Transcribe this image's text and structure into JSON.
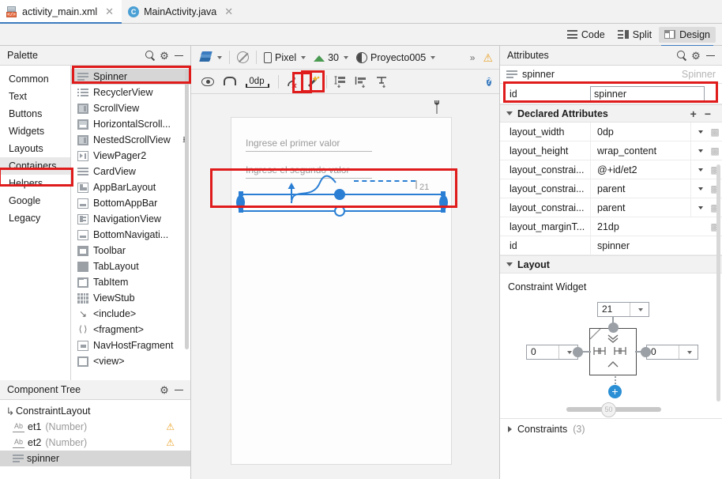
{
  "tabs": [
    {
      "label": "activity_main.xml",
      "icon": "xml-file-icon",
      "active": true
    },
    {
      "label": "MainActivity.java",
      "icon": "java-class-icon",
      "active": false
    }
  ],
  "modebar": {
    "code_label": "Code",
    "split_label": "Split",
    "design_label": "Design",
    "active": "Design"
  },
  "palette": {
    "title": "Palette",
    "categories": [
      {
        "label": "Common",
        "selected": false
      },
      {
        "label": "Text",
        "selected": false
      },
      {
        "label": "Buttons",
        "selected": false
      },
      {
        "label": "Widgets",
        "selected": false
      },
      {
        "label": "Layouts",
        "selected": false
      },
      {
        "label": "Containers",
        "selected": true
      },
      {
        "label": "Helpers",
        "selected": false
      },
      {
        "label": "Google",
        "selected": false
      },
      {
        "label": "Legacy",
        "selected": false
      }
    ],
    "items": [
      {
        "label": "Spinner",
        "selected": true,
        "download": false
      },
      {
        "label": "RecyclerView",
        "selected": false,
        "download": false
      },
      {
        "label": "ScrollView",
        "selected": false,
        "download": false
      },
      {
        "label": "HorizontalScroll...",
        "selected": false,
        "download": false
      },
      {
        "label": "NestedScrollView",
        "selected": false,
        "download": true
      },
      {
        "label": "ViewPager2",
        "selected": false,
        "download": false
      },
      {
        "label": "CardView",
        "selected": false,
        "download": false
      },
      {
        "label": "AppBarLayout",
        "selected": false,
        "download": false
      },
      {
        "label": "BottomAppBar",
        "selected": false,
        "download": false
      },
      {
        "label": "NavigationView",
        "selected": false,
        "download": false
      },
      {
        "label": "BottomNavigati...",
        "selected": false,
        "download": false
      },
      {
        "label": "Toolbar",
        "selected": false,
        "download": false
      },
      {
        "label": "TabLayout",
        "selected": false,
        "download": false
      },
      {
        "label": "TabItem",
        "selected": false,
        "download": false
      },
      {
        "label": "ViewStub",
        "selected": false,
        "download": false
      },
      {
        "label": "<include>",
        "selected": false,
        "download": false
      },
      {
        "label": "<fragment>",
        "selected": false,
        "download": false
      },
      {
        "label": "NavHostFragment",
        "selected": false,
        "download": false
      },
      {
        "label": "<view>",
        "selected": false,
        "download": false
      }
    ]
  },
  "component_tree": {
    "title": "Component Tree",
    "rows": [
      {
        "label": "ConstraintLayout",
        "sub": "",
        "warning": false,
        "selected": false,
        "depth": 0,
        "icon": "constraintlayout-icon"
      },
      {
        "label": "et1",
        "sub": "(Number)",
        "warning": true,
        "selected": false,
        "depth": 1,
        "icon": "textfield-icon"
      },
      {
        "label": "et2",
        "sub": "(Number)",
        "warning": true,
        "selected": false,
        "depth": 1,
        "icon": "textfield-icon"
      },
      {
        "label": "spinner",
        "sub": "",
        "warning": false,
        "selected": true,
        "depth": 1,
        "icon": "spinner-icon"
      }
    ]
  },
  "design_toolbar": {
    "device_label": "Pixel",
    "api_label": "30",
    "theme_label": "Proyecto005",
    "overflow_label": "»",
    "default_margin_label": "0dp"
  },
  "canvas": {
    "hint_first": "Ingrese el primer valor",
    "hint_second": "Ingrese el segundo valor",
    "margin_label": "21"
  },
  "attributes": {
    "title": "Attributes",
    "object_name": "spinner",
    "object_class": "Spinner",
    "id_key": "id",
    "id_value": "spinner",
    "declared_header": "Declared Attributes",
    "rows": [
      {
        "key": "layout_width",
        "value": "0dp",
        "dropdown": true
      },
      {
        "key": "layout_height",
        "value": "wrap_content",
        "dropdown": true
      },
      {
        "key": "layout_constrai...",
        "value": "@+id/et2",
        "dropdown": true
      },
      {
        "key": "layout_constrai...",
        "value": "parent",
        "dropdown": true
      },
      {
        "key": "layout_constrai...",
        "value": "parent",
        "dropdown": true
      },
      {
        "key": "layout_marginT...",
        "value": "21dp",
        "dropdown": false
      },
      {
        "key": "id",
        "value": "spinner",
        "dropdown": false
      }
    ],
    "layout_header": "Layout",
    "constraint_widget_label": "Constraint Widget",
    "margin_top": "21",
    "margin_left": "0",
    "margin_right": "0",
    "bias_value": "50",
    "constraints_label": "Constraints",
    "constraints_count": "(3)"
  },
  "colors": {
    "accent_blue": "#2a7fd4",
    "highlight_red": "#e01b1b",
    "warning_amber": "#e9a227",
    "panel_bg": "#f2f2f2",
    "selection_gray": "#d6d6d6"
  }
}
